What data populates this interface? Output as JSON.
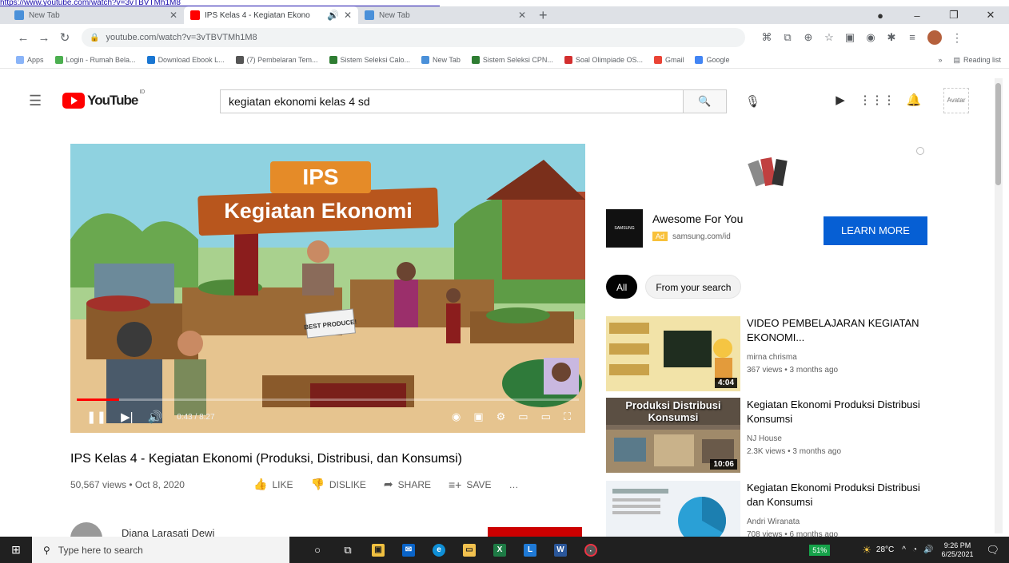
{
  "browser": {
    "top_link": "https://www.youtube.com/watch?v=3vTBVTMh1M8",
    "tabs": [
      {
        "label": "New Tab",
        "favicon_color": "#4a90d9"
      },
      {
        "label": "IPS Kelas 4 - Kegiatan Ekono",
        "favicon_color": "#ff0000"
      },
      {
        "label": "New Tab",
        "favicon_color": "#4a90d9"
      }
    ],
    "window_controls": [
      "–",
      "❐",
      "✕"
    ],
    "url": "youtube.com/watch?v=3vTBVTMh1M8",
    "bookmarks": [
      {
        "label": "Apps",
        "color": "#8ab4f8"
      },
      {
        "label": "Login - Rumah Bela...",
        "color": "#4caf50"
      },
      {
        "label": "Download Ebook L...",
        "color": "#1976d2"
      },
      {
        "label": "(7) Pembelaran Tem...",
        "color": "#555555"
      },
      {
        "label": "Sistem Seleksi Calo...",
        "color": "#2e7d32"
      },
      {
        "label": "New Tab",
        "color": "#4a90d9"
      },
      {
        "label": "Sistem Seleksi CPN...",
        "color": "#2e7d32"
      },
      {
        "label": "Soal Olimpiade OS...",
        "color": "#d32f2f"
      },
      {
        "label": "Gmail",
        "color": "#ea4335"
      },
      {
        "label": "Google",
        "color": "#4285f4"
      }
    ],
    "reading_list": "Reading list"
  },
  "youtube": {
    "logo_text": "YouTube",
    "logo_region": "ID",
    "search_query": "kegiatan ekonomi kelas 4 sd",
    "avatar_alt": "Avatar"
  },
  "video": {
    "banner_ips": "IPS",
    "banner_title": "Kegiatan Ekonomi",
    "sign_text": "BEST PRODUCE!",
    "time": "0:43 / 8:27",
    "progress": 0.085,
    "title": "IPS Kelas 4 - Kegiatan Ekonomi (Produksi, Distribusi, dan Konsumsi)",
    "meta": "50,567 views • Oct 8, 2020",
    "actions": [
      {
        "icon": "👍",
        "label": "LIKE"
      },
      {
        "icon": "👎",
        "label": "DISLIKE"
      },
      {
        "icon": "➦",
        "label": "SHARE"
      },
      {
        "icon": "≡+",
        "label": "SAVE"
      }
    ],
    "more": "…",
    "channel_name": "Diana Larasati Dewi"
  },
  "ad": {
    "logo": "SAMSUNG",
    "title": "Awesome For You",
    "badge": "Ad",
    "domain": "samsung.com/id",
    "button": "LEARN MORE"
  },
  "chips": [
    "All",
    "From your search"
  ],
  "recommendations": [
    {
      "title": "VIDEO PEMBELAJARAN KEGIATAN EKONOMI...",
      "channel": "mirna chrisma",
      "views": "367 views • 3 months ago",
      "duration": "4:04"
    },
    {
      "title": "Kegiatan Ekonomi Produksi Distribusi Konsumsi",
      "channel": "NJ House",
      "views": "2.3K views • 3 months ago",
      "duration": "10:06",
      "thumb_text": "Produksi Distribusi Konsumsi"
    },
    {
      "title": "Kegiatan Ekonomi Produksi Distribusi dan Konsumsi",
      "channel": "Andri Wiranata",
      "views": "708 views • 6 months ago",
      "duration": ""
    }
  ],
  "taskbar": {
    "search_placeholder": "Type here to search",
    "battery": "51%",
    "weather": "28°C",
    "time": "9:26 PM",
    "date": "6/25/2021"
  }
}
